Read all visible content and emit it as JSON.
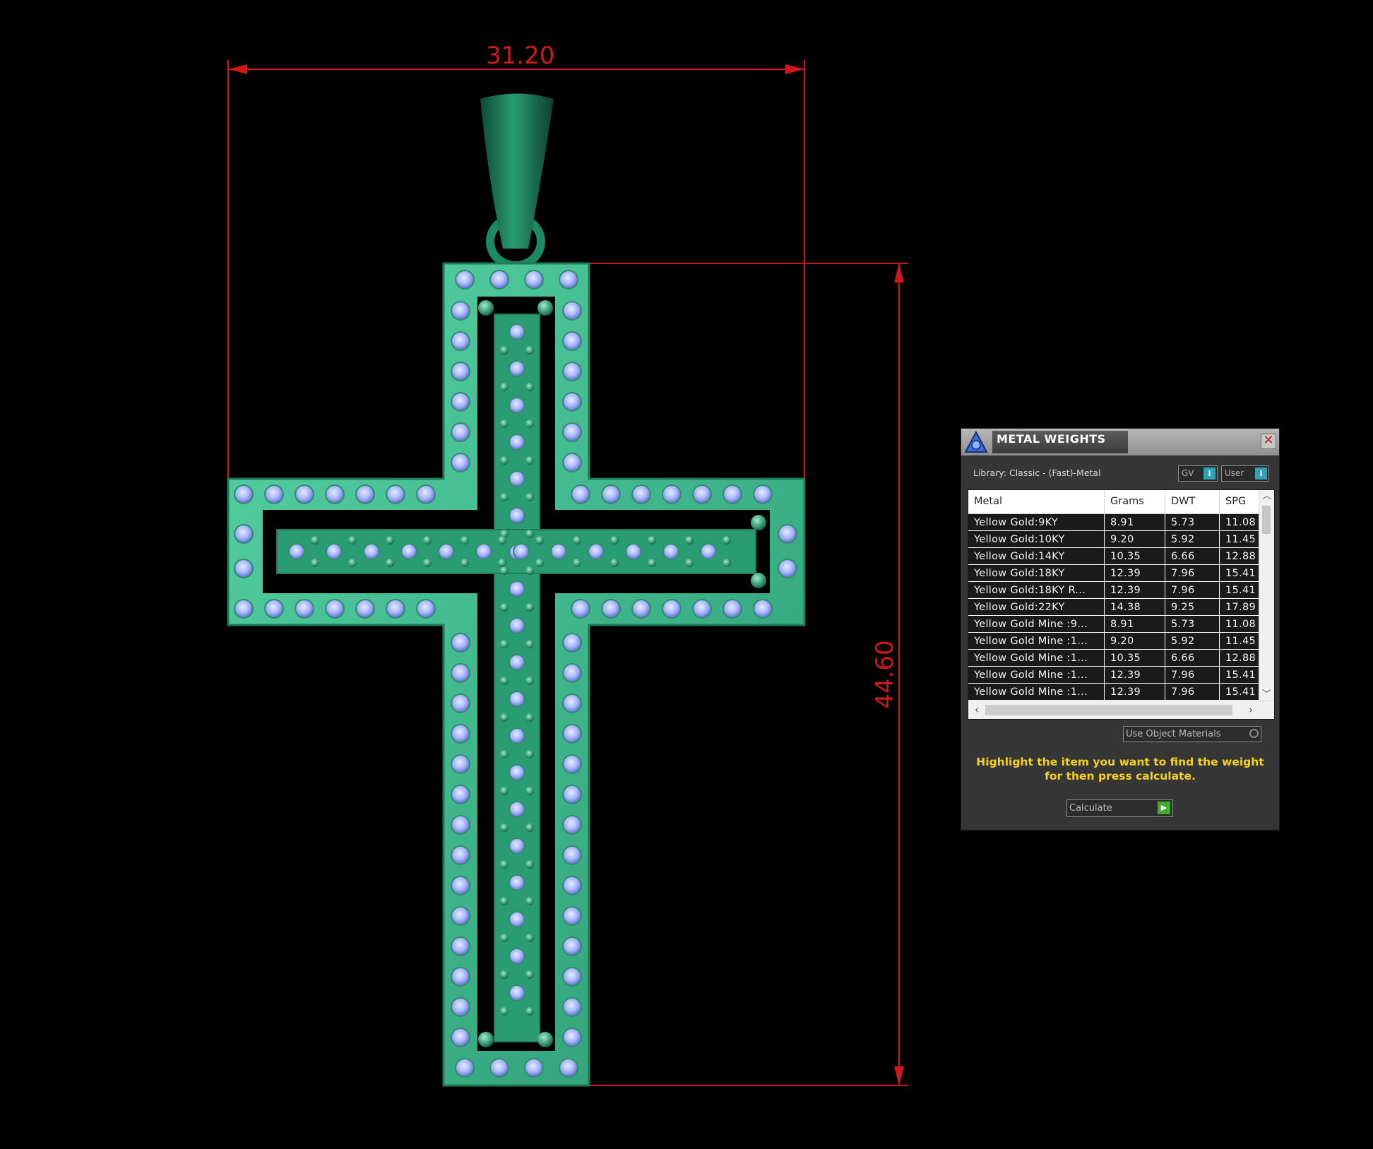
{
  "dimensions": {
    "width_label": "31.20",
    "height_label": "44.60",
    "line_color": "#d01818"
  },
  "model": {
    "metal_color": "#3fb58c",
    "stone_color": "#a9b8ff",
    "icon": "cross-pendant"
  },
  "panel": {
    "title": "METAL WEIGHTS",
    "close_glyph": "✕",
    "library_label": "Library: Classic - (Fast)-Metal",
    "toggles": [
      {
        "label": "GV",
        "state": "I"
      },
      {
        "label": "User",
        "state": "I"
      }
    ],
    "columns": [
      "Metal",
      "Grams",
      "DWT",
      "SPG"
    ],
    "rows": [
      {
        "metal": "Yellow Gold:9KY",
        "grams": "8.91",
        "dwt": "5.73",
        "spg": "11.08"
      },
      {
        "metal": "Yellow Gold:10KY",
        "grams": "9.20",
        "dwt": "5.92",
        "spg": "11.45"
      },
      {
        "metal": "Yellow Gold:14KY",
        "grams": "10.35",
        "dwt": "6.66",
        "spg": "12.88"
      },
      {
        "metal": "Yellow Gold:18KY",
        "grams": "12.39",
        "dwt": "7.96",
        "spg": "15.41"
      },
      {
        "metal": "Yellow Gold:18KY R...",
        "grams": "12.39",
        "dwt": "7.96",
        "spg": "15.41"
      },
      {
        "metal": "Yellow Gold:22KY",
        "grams": "14.38",
        "dwt": "9.25",
        "spg": "17.89"
      },
      {
        "metal": "Yellow Gold Mine :9...",
        "grams": "8.91",
        "dwt": "5.73",
        "spg": "11.08"
      },
      {
        "metal": "Yellow Gold Mine :1...",
        "grams": "9.20",
        "dwt": "5.92",
        "spg": "11.45"
      },
      {
        "metal": "Yellow Gold Mine :1...",
        "grams": "10.35",
        "dwt": "6.66",
        "spg": "12.88"
      },
      {
        "metal": "Yellow Gold Mine :1...",
        "grams": "12.39",
        "dwt": "7.96",
        "spg": "15.41"
      },
      {
        "metal": "Yellow Gold Mine :1...",
        "grams": "12.39",
        "dwt": "7.96",
        "spg": "15.41"
      }
    ],
    "use_object_materials_label": "Use Object Materials",
    "instructions": "Highlight the item you want to find the weight for then press calculate.",
    "calculate_label": "Calculate",
    "accent_color": "#f6d21c"
  }
}
